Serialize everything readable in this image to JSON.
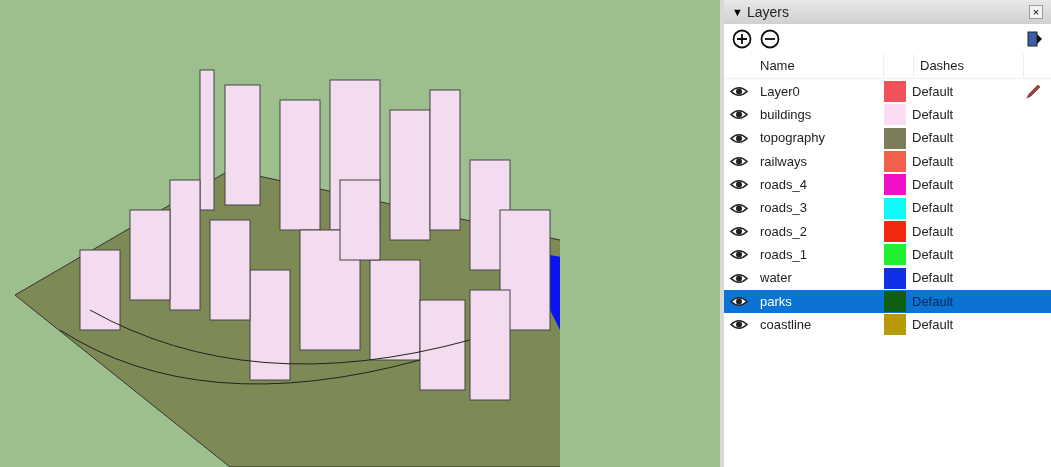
{
  "panel": {
    "title": "Layers",
    "collapse_glyph": "▼",
    "close_glyph": "×"
  },
  "columns": {
    "name": "Name",
    "dashes": "Dashes"
  },
  "layers": [
    {
      "name": "Layer0",
      "color": "#f0525a",
      "dashes": "Default",
      "visible": true,
      "active": true,
      "selected": false
    },
    {
      "name": "buildings",
      "color": "#fadcf5",
      "dashes": "Default",
      "visible": true,
      "active": false,
      "selected": false
    },
    {
      "name": "topography",
      "color": "#7c7e5a",
      "dashes": "Default",
      "visible": true,
      "active": false,
      "selected": false
    },
    {
      "name": "railways",
      "color": "#f0604a",
      "dashes": "Default",
      "visible": true,
      "active": false,
      "selected": false
    },
    {
      "name": "roads_4",
      "color": "#f010c8",
      "dashes": "Default",
      "visible": true,
      "active": false,
      "selected": false
    },
    {
      "name": "roads_3",
      "color": "#10f8f8",
      "dashes": "Default",
      "visible": true,
      "active": false,
      "selected": false
    },
    {
      "name": "roads_2",
      "color": "#f02a10",
      "dashes": "Default",
      "visible": true,
      "active": false,
      "selected": false
    },
    {
      "name": "roads_1",
      "color": "#20f030",
      "dashes": "Default",
      "visible": true,
      "active": false,
      "selected": false
    },
    {
      "name": "water",
      "color": "#1030e8",
      "dashes": "Default",
      "visible": true,
      "active": false,
      "selected": false
    },
    {
      "name": "parks",
      "color": "#0c6010",
      "dashes": "Default",
      "visible": true,
      "active": false,
      "selected": true
    },
    {
      "name": "coastline",
      "color": "#b89a08",
      "dashes": "Default",
      "visible": true,
      "active": false,
      "selected": false
    }
  ]
}
